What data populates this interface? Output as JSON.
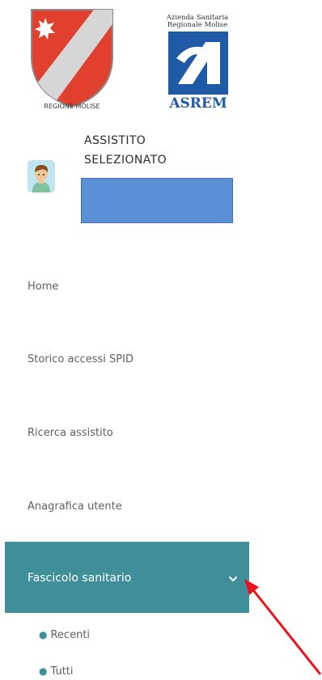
{
  "logos": {
    "region_caption": "REGIONE MOLISE",
    "asrem_line1": "Azienda Sanitaria",
    "asrem_line2": "Regionale Molise",
    "asrem_name": "ASREM"
  },
  "assistito": {
    "title_line1": "ASSISTITO",
    "title_line2": "SELEZIONATO"
  },
  "menu": {
    "items": [
      {
        "label": "Home"
      },
      {
        "label": "Storico accessi SPID"
      },
      {
        "label": "Ricerca assistito"
      },
      {
        "label": "Anagrafica utente"
      }
    ],
    "active": {
      "label": "Fascicolo sanitario"
    },
    "sub_items": [
      {
        "label": "Recenti"
      },
      {
        "label": "Tutti"
      }
    ]
  },
  "colors": {
    "active_bg": "#3e8f9a",
    "redacted_box": "#5b8fd6",
    "arrow": "#e8131b"
  },
  "icons": {
    "chevron": "chevron-down-icon",
    "avatar": "user-avatar-icon"
  }
}
